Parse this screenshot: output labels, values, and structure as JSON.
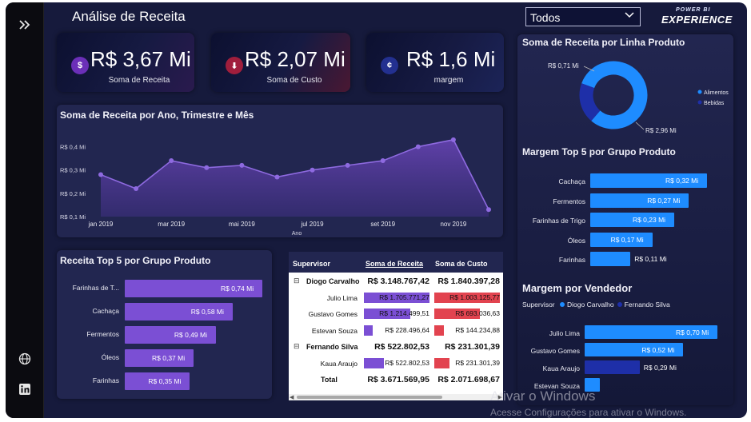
{
  "page": {
    "title": "Análise de Receita"
  },
  "slicer": {
    "value": "Todos"
  },
  "logo": {
    "line1": "POWER BI",
    "line2": "EXPERIENCE"
  },
  "kpis": [
    {
      "value": "R$ 3,67 Mi",
      "label": "Soma de Receita",
      "icon": "money-bag-icon",
      "color": "#8a3bd6"
    },
    {
      "value": "R$ 2,07 Mi",
      "label": "Soma de Custo",
      "icon": "cost-icon",
      "color": "#d0284a"
    },
    {
      "value": "R$ 1,6 Mi",
      "label": "margem",
      "icon": "coins-icon",
      "color": "#3a48c8"
    }
  ],
  "line_chart": {
    "title": "Soma de Receita por Ano, Trimestre e Mês",
    "xlabel": "Ano",
    "x_ticks": [
      "jan 2019",
      "mar 2019",
      "mai 2019",
      "jul 2019",
      "set 2019",
      "nov 2019"
    ],
    "y_ticks": [
      "R$ 0,4 Mi",
      "R$ 0,3 Mi",
      "R$ 0,2 Mi",
      "R$ 0,1 Mi"
    ]
  },
  "bar_receita": {
    "title": "Receita Top 5 por Grupo Produto",
    "labels": [
      "R$ 0,74 Mi",
      "R$ 0,58 Mi",
      "R$ 0,49 Mi",
      "R$ 0,37 Mi",
      "R$ 0,35 Mi"
    ]
  },
  "donut": {
    "title": "Soma de Receita por Linha Produto",
    "labels": [
      "R$ 0,71 Mi",
      "R$ 2,96 Mi"
    ]
  },
  "bar_margem_produto": {
    "title": "Margem Top 5 por Grupo Produto",
    "labels": [
      "R$ 0,32 Mi",
      "R$ 0,27 Mi",
      "R$ 0,23 Mi",
      "R$ 0,17 Mi",
      "R$ 0,11 Mi"
    ]
  },
  "bar_margem_vendedor": {
    "title": "Margem por Vendedor",
    "legend_title": "Supervisor",
    "labels": [
      "R$ 0,70 Mi",
      "R$ 0,52 Mi",
      "R$ 0,29 Mi",
      ""
    ]
  },
  "chart_data": [
    {
      "type": "line",
      "title": "Soma de Receita por Ano, Trimestre e Mês",
      "xlabel": "Ano",
      "ylabel": "",
      "x": [
        "jan 2019",
        "fev 2019",
        "mar 2019",
        "abr 2019",
        "mai 2019",
        "jun 2019",
        "jul 2019",
        "ago 2019",
        "set 2019",
        "out 2019",
        "nov 2019",
        "dez 2019"
      ],
      "values": [
        0.28,
        0.22,
        0.34,
        0.31,
        0.32,
        0.27,
        0.3,
        0.32,
        0.34,
        0.4,
        0.43,
        0.13
      ],
      "ylim": [
        0.1,
        0.45
      ]
    },
    {
      "type": "bar",
      "title": "Receita Top 5 por Grupo Produto",
      "categories": [
        "Farinhas de T...",
        "Cachaça",
        "Fermentos",
        "Óleos",
        "Farinhas"
      ],
      "values": [
        0.74,
        0.58,
        0.49,
        0.37,
        0.35
      ],
      "color": "#7b4fd4"
    },
    {
      "type": "pie",
      "title": "Soma de Receita por Linha Produto",
      "categories": [
        "Alimentos",
        "Bebidas"
      ],
      "values": [
        2.96,
        0.71
      ],
      "colors": [
        "#1e8cff",
        "#1e2fa8"
      ]
    },
    {
      "type": "bar",
      "title": "Margem Top 5 por Grupo Produto",
      "categories": [
        "Cachaça",
        "Fermentos",
        "Farinhas de Trigo",
        "Óleos",
        "Farinhas"
      ],
      "values": [
        0.32,
        0.27,
        0.23,
        0.17,
        0.11
      ],
      "color": "#1e8cff"
    },
    {
      "type": "bar",
      "title": "Margem por Vendedor",
      "categories": [
        "Julio Lima",
        "Gustavo Gomes",
        "Kaua Araujo",
        "Estevan Souza"
      ],
      "values": [
        0.7,
        0.52,
        0.29,
        0.08
      ],
      "supervisor": [
        "Diogo Carvalho",
        "Diogo Carvalho",
        "Fernando Silva",
        "Diogo Carvalho"
      ],
      "legend": [
        {
          "name": "Diogo Carvalho",
          "color": "#1e8cff"
        },
        {
          "name": "Fernando Silva",
          "color": "#1e2fa8"
        }
      ]
    },
    {
      "type": "table",
      "columns": [
        "Supervisor",
        "Soma de Receita",
        "Soma de Custo"
      ],
      "rows": [
        {
          "name": "Diogo Carvalho",
          "level": 0,
          "receita": "R$ 3.148.767,42",
          "custo": "R$ 1.840.397,28"
        },
        {
          "name": "Julio Lima",
          "level": 1,
          "receita": "R$ 1.705.771,27",
          "custo": "R$ 1.003.125,77",
          "r": 1.7058,
          "c": 1.0031
        },
        {
          "name": "Gustavo Gomes",
          "level": 1,
          "receita": "R$ 1.214.499,51",
          "custo": "R$ 693.036,63",
          "r": 1.2145,
          "c": 0.693
        },
        {
          "name": "Estevan Souza",
          "level": 1,
          "receita": "R$ 228.496,64",
          "custo": "R$ 144.234,88",
          "r": 0.2285,
          "c": 0.1442
        },
        {
          "name": "Fernando Silva",
          "level": 0,
          "receita": "R$ 522.802,53",
          "custo": "R$ 231.301,39"
        },
        {
          "name": "Kaua Araujo",
          "level": 1,
          "receita": "R$ 522.802,53",
          "custo": "R$ 231.301,39",
          "r": 0.5228,
          "c": 0.2313
        },
        {
          "name": "Total",
          "level": 2,
          "receita": "R$ 3.671.569,95",
          "custo": "R$ 2.071.698,67"
        }
      ]
    }
  ],
  "watermark": {
    "line1": "Ativar o Windows",
    "line2": "Acesse Configurações para ativar o Windows."
  }
}
